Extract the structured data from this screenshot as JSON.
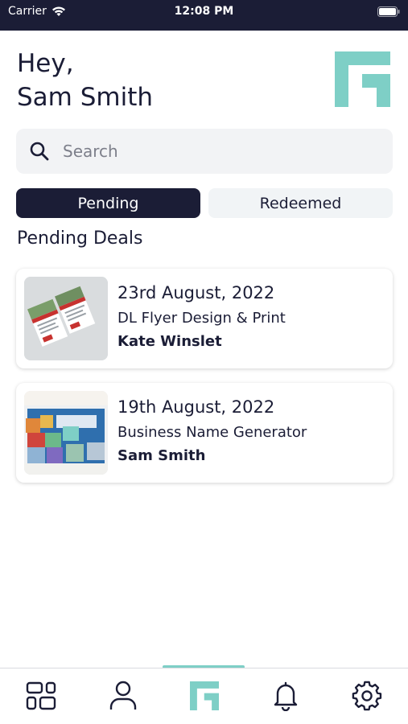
{
  "status_bar": {
    "carrier": "Carrier",
    "time": "12:08 PM"
  },
  "header": {
    "greeting_line1": "Hey,",
    "greeting_line2": "Sam Smith"
  },
  "search": {
    "placeholder": "Search",
    "value": ""
  },
  "tabs": [
    {
      "label": "Pending",
      "active": true
    },
    {
      "label": "Redeemed",
      "active": false
    }
  ],
  "section_title": "Pending Deals",
  "deals": [
    {
      "date": "23rd August, 2022",
      "title": "DL Flyer Design & Print",
      "name": "Kate Winslet",
      "thumbnail_icon": "flyer-thumbnail"
    },
    {
      "date": "19th August, 2022",
      "title": "Business Name Generator",
      "name": "Sam Smith",
      "thumbnail_icon": "domain-blocks-thumbnail"
    }
  ],
  "bottom_nav": [
    {
      "icon": "dashboard-icon",
      "active": false
    },
    {
      "icon": "profile-icon",
      "active": false
    },
    {
      "icon": "brand-logo-icon",
      "active": true
    },
    {
      "icon": "bell-icon",
      "active": false
    },
    {
      "icon": "gear-icon",
      "active": false
    }
  ],
  "colors": {
    "primary_navy": "#1b1d36",
    "accent_teal": "#7ecfc6",
    "surface_grey": "#f2f3f5"
  }
}
